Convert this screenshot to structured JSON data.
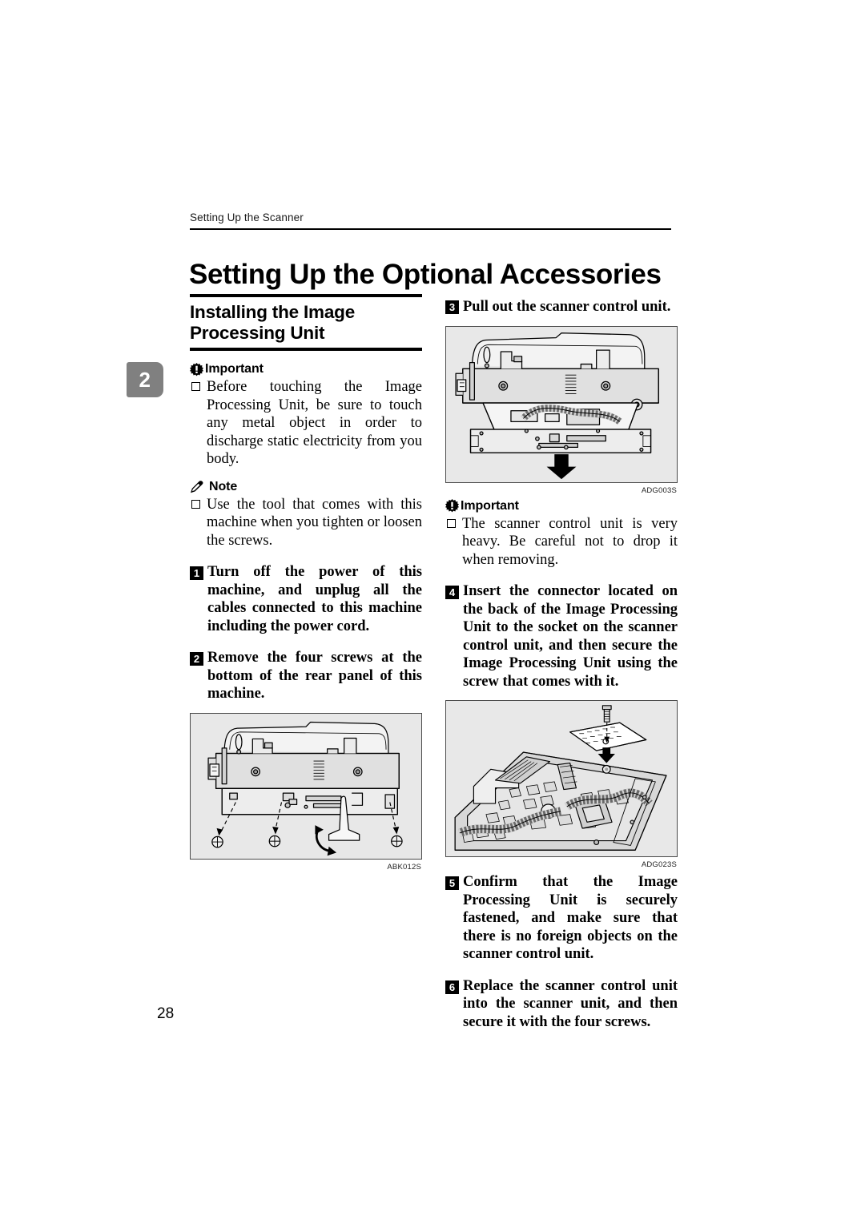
{
  "header": {
    "running_head": "Setting Up the Scanner",
    "page_title": "Setting Up the Optional Accessories"
  },
  "chapter_tab": {
    "number": "2",
    "color": "#808080"
  },
  "page_number": "28",
  "left_column": {
    "section_heading": "Installing the Image Processing Unit",
    "important": {
      "label": "Important",
      "items": [
        "Before touching the Image Processing Unit, be sure to touch any metal object in order to discharge static electricity from you body."
      ]
    },
    "note": {
      "label": "Note",
      "items": [
        "Use the tool that comes with this machine when you tighten or loosen the screws."
      ]
    },
    "steps": [
      {
        "number": "1",
        "text": "Turn off the power of this machine, and unplug all the cables connected to this machine including the power cord."
      },
      {
        "number": "2",
        "text": "Remove the four screws at the bottom of the rear panel of this machine."
      }
    ],
    "figure": {
      "label": "ABK012S",
      "caption": "Rear panel of the machine with four screws and the supplied tool"
    }
  },
  "right_column": {
    "step_3": {
      "number": "3",
      "text": "Pull out the scanner control unit."
    },
    "figure_1": {
      "label": "ADG003S",
      "caption": "Scanner with the control unit sliding out, downward arrow"
    },
    "important": {
      "label": "Important",
      "items": [
        "The scanner control unit is very heavy. Be careful not to drop it when removing."
      ]
    },
    "step_4": {
      "number": "4",
      "text": "Insert the connector located on the back of the Image Processing Unit to the socket on the scanner control unit, and then secure the Image Processing Unit using the screw that comes with it."
    },
    "figure_2": {
      "label": "ADG023S",
      "caption": "Scanner control unit circuit board with ribbon cables and screw installation"
    },
    "steps": [
      {
        "number": "5",
        "text": "Confirm that the Image Processing Unit is securely fastened, and make sure that there is no foreign objects on the scanner control unit."
      },
      {
        "number": "6",
        "text": "Replace the scanner control unit into the scanner unit, and then secure it with the four screws."
      }
    ]
  }
}
